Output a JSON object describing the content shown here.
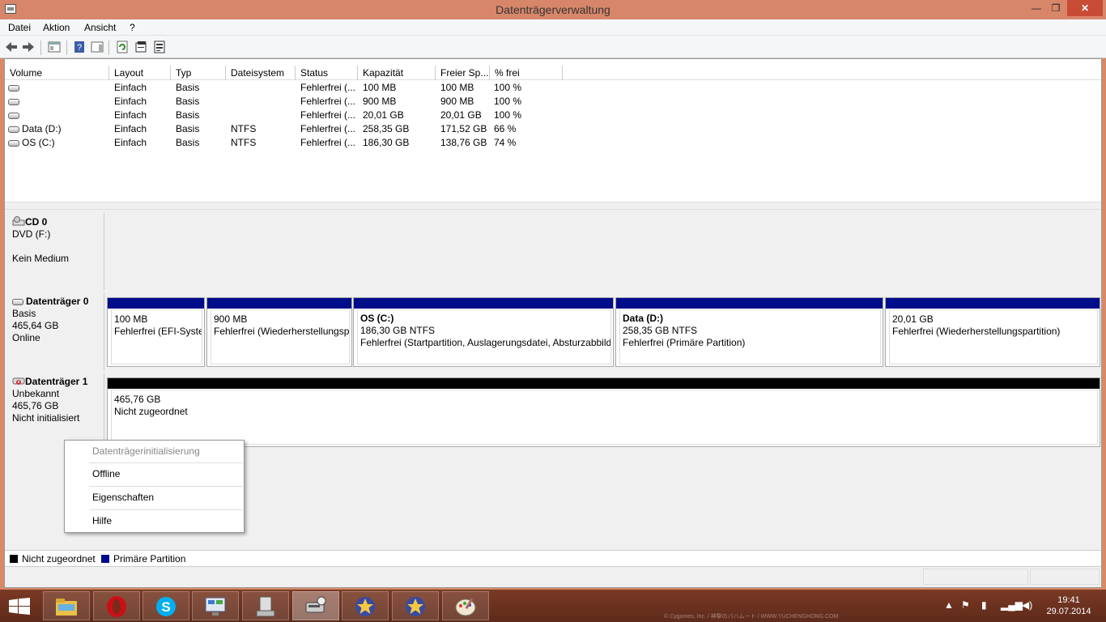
{
  "window": {
    "title": "Datenträgerverwaltung",
    "minimize": "—",
    "maximize": "❐",
    "close": "✕"
  },
  "menu": {
    "items": [
      "Datei",
      "Aktion",
      "Ansicht",
      "?"
    ]
  },
  "toolbar": {
    "icons": [
      "back-arrow-icon",
      "forward-arrow-icon",
      "console-tree-icon",
      "help-icon",
      "action-pane-icon",
      "refresh-icon",
      "properties-icon",
      "rescan-icon"
    ]
  },
  "volume_table": {
    "headers": [
      "Volume",
      "Layout",
      "Typ",
      "Dateisystem",
      "Status",
      "Kapazität",
      "Freier Sp...",
      "% frei"
    ],
    "rows": [
      {
        "volume": "",
        "layout": "Einfach",
        "typ": "Basis",
        "fs": "",
        "status": "Fehlerfrei (...",
        "capacity": "100 MB",
        "free": "100 MB",
        "pct": "100 %"
      },
      {
        "volume": "",
        "layout": "Einfach",
        "typ": "Basis",
        "fs": "",
        "status": "Fehlerfrei (...",
        "capacity": "900 MB",
        "free": "900 MB",
        "pct": "100 %"
      },
      {
        "volume": "",
        "layout": "Einfach",
        "typ": "Basis",
        "fs": "",
        "status": "Fehlerfrei (...",
        "capacity": "20,01 GB",
        "free": "20,01 GB",
        "pct": "100 %"
      },
      {
        "volume": "Data (D:)",
        "layout": "Einfach",
        "typ": "Basis",
        "fs": "NTFS",
        "status": "Fehlerfrei (...",
        "capacity": "258,35 GB",
        "free": "171,52 GB",
        "pct": "66 %"
      },
      {
        "volume": "OS (C:)",
        "layout": "Einfach",
        "typ": "Basis",
        "fs": "NTFS",
        "status": "Fehlerfrei (...",
        "capacity": "186,30 GB",
        "free": "138,76 GB",
        "pct": "74 %"
      }
    ]
  },
  "disks": {
    "cd0": {
      "name": "CD 0",
      "line1": "DVD (F:)",
      "line2": "",
      "line3": "Kein Medium"
    },
    "disk0": {
      "name": "Datenträger 0",
      "line1": "Basis",
      "line2": "465,64 GB",
      "line3": "Online",
      "partitions": [
        {
          "title": "",
          "size": "100 MB",
          "status": "Fehlerfrei (EFI-Systempartition)"
        },
        {
          "title": "",
          "size": "900 MB",
          "status": "Fehlerfrei (Wiederherstellungspartition)"
        },
        {
          "title": "OS  (C:)",
          "size": "186,30 GB NTFS",
          "status": "Fehlerfrei (Startpartition, Auslagerungsdatei, Absturzabbild"
        },
        {
          "title": "Data  (D:)",
          "size": "258,35 GB NTFS",
          "status": "Fehlerfrei (Primäre Partition)"
        },
        {
          "title": "",
          "size": "20,01 GB",
          "status": "Fehlerfrei (Wiederherstellungspartition)"
        }
      ]
    },
    "disk1": {
      "name": "Datenträger 1",
      "line1": "Unbekannt",
      "line2": "465,76 GB",
      "line3": "Nicht initialisiert",
      "partition": {
        "size": "465,76 GB",
        "status": "Nicht zugeordnet"
      }
    }
  },
  "legend": {
    "unallocated": "Nicht zugeordnet",
    "primary": "Primäre Partition",
    "unallocated_color": "#000000",
    "primary_color": "#000d8a"
  },
  "context_menu": {
    "items": [
      "Datenträgerinitialisierung",
      "Offline",
      "Eigenschaften",
      "Hilfe"
    ]
  },
  "taskbar": {
    "apps": [
      "file-explorer-icon",
      "opera-icon",
      "skype-icon",
      "control-panel-icon",
      "device-manager-icon",
      "disk-management-icon",
      "game-star-icon",
      "game-star-icon",
      "paint-icon"
    ],
    "watermark": "© Cygames, Inc. / 神撃のバハムート / WWW.YUCHENGHONG.COM",
    "time": "19:41",
    "date": "29.07.2014"
  }
}
